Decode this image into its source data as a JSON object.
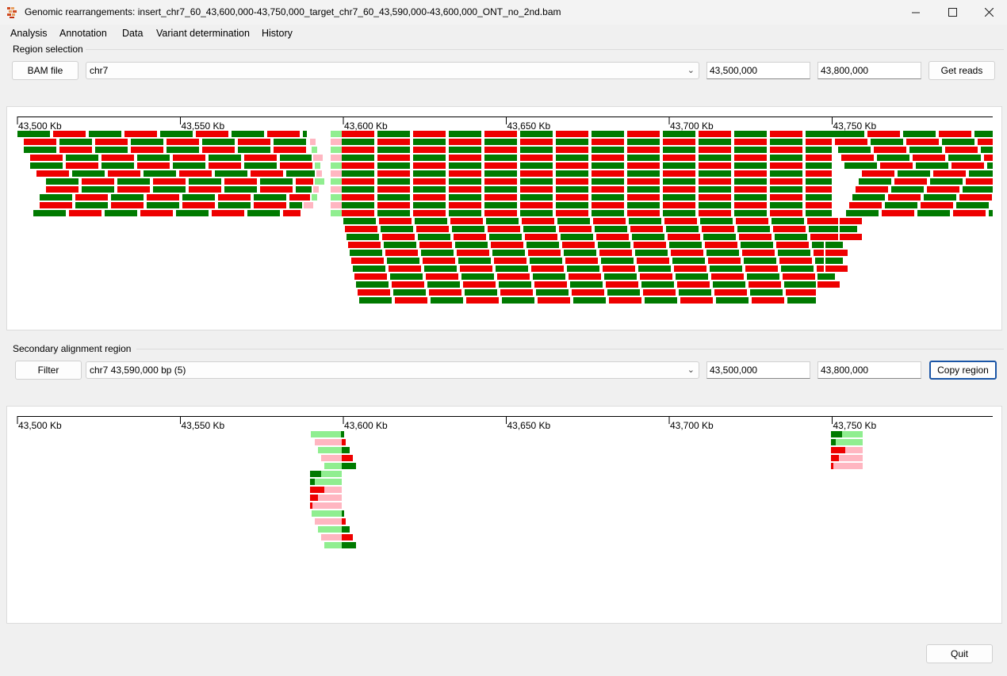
{
  "window": {
    "title": "Genomic rearrangements: insert_chr7_60_43,600,000-43,750,000_target_chr7_60_43,590,000-43,600,000_ONT_no_2nd.bam",
    "controls": [
      "minimize-icon",
      "maximize-icon",
      "close-icon"
    ]
  },
  "menu": [
    "Analysis",
    "Annotation",
    "Data",
    "Variant determination",
    "History"
  ],
  "region_selection": {
    "label": "Region selection",
    "bam_button": "BAM file",
    "chromosome": "chr7",
    "start": "43,500,000",
    "end": "43,800,000",
    "get_reads_button": "Get reads"
  },
  "secondary": {
    "label": "Secondary alignment region",
    "filter_button": "Filter",
    "region": "chr7 43,590,000 bp (5)",
    "start": "43,500,000",
    "end": "43,800,000",
    "copy_button": "Copy region"
  },
  "axis": {
    "ticks": [
      "43,500 Kb",
      "43,550 Kb",
      "43,600 Kb",
      "43,650 Kb",
      "43,700 Kb",
      "43,750 Kb"
    ],
    "tick_values_kb": [
      43500,
      43550,
      43600,
      43650,
      43700,
      43750
    ],
    "range_kb": [
      43500,
      43800
    ]
  },
  "colors": {
    "forward": "#007a00",
    "reverse": "#ee0000",
    "forward_clip": "#90ee90",
    "reverse_clip": "#ffb6c1"
  },
  "quit_button": "Quit"
}
